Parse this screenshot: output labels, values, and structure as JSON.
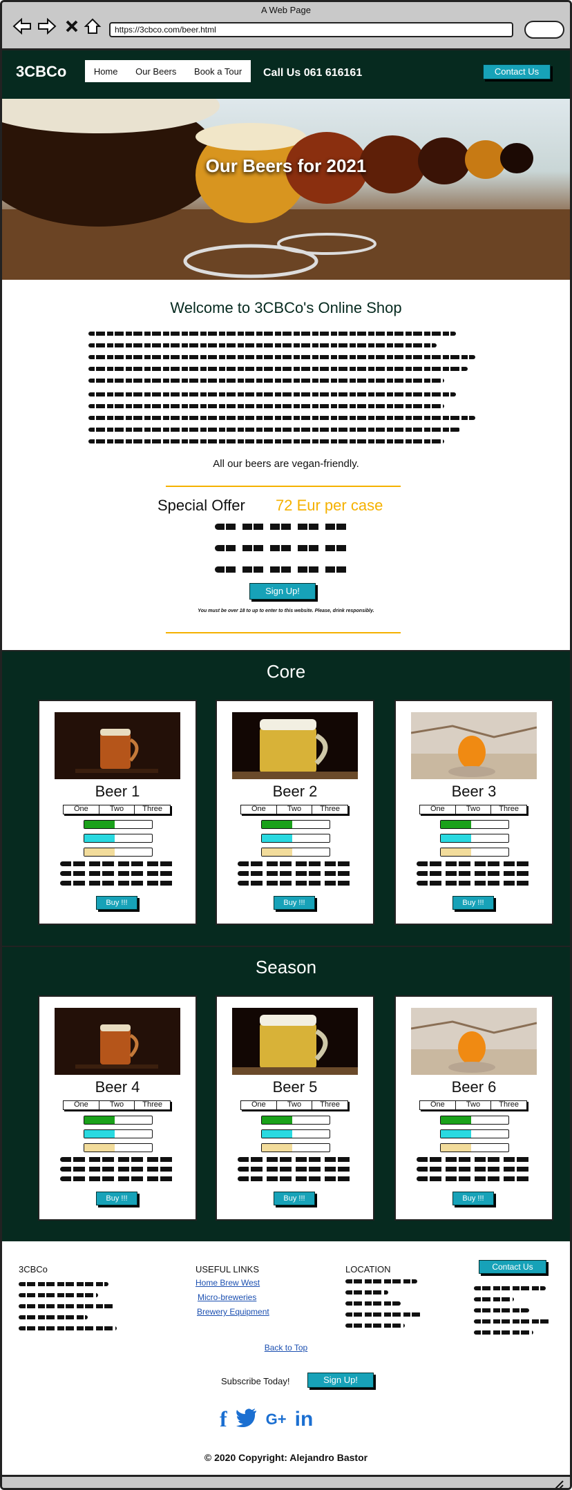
{
  "window": {
    "title": "A Web Page",
    "url": "https://3cbco.com/beer.html"
  },
  "header": {
    "brand": "3CBCo",
    "nav": [
      "Home",
      "Our Beers",
      "Book a Tour"
    ],
    "call": "Call Us 061 616161",
    "contact_label": "Contact Us"
  },
  "hero": {
    "title": "Our Beers for 2021"
  },
  "intro": {
    "welcome": "Welcome to 3CBCo's Online Shop",
    "vegan": "All our beers are vegan-friendly.",
    "offer_label": "Special Offer",
    "offer_price": "72 Eur per case",
    "signup_label": "Sign Up!",
    "disclaimer": "You must be over 18 to up to enter to this website. Please, drink responsibly."
  },
  "sections": [
    {
      "title": "Core"
    },
    {
      "title": "Season"
    }
  ],
  "cards": {
    "sizes": [
      "One",
      "Two",
      "Three"
    ],
    "buy_label": "Buy !!!",
    "bar_colors": [
      "#1aa11a",
      "#29d9e0",
      "#f2dc9b"
    ],
    "bar_levels": [
      0.45,
      0.45,
      0.45
    ],
    "beers": [
      "Beer 1",
      "Beer 2",
      "Beer 3",
      "Beer 4",
      "Beer 5",
      "Beer 6"
    ]
  },
  "footer": {
    "brand": "3CBCo",
    "links_heading": "USEFUL LINKS",
    "links": [
      "Home Brew West",
      "Micro-breweries",
      "Brewery Equipment"
    ],
    "location_heading": "LOCATION",
    "contact_label": "Contact Us",
    "back_to_top": "Back to Top",
    "subscribe": "Subscribe Today!",
    "signup_label": "Sign Up!",
    "social": [
      "f",
      "twitter",
      "G+",
      "in"
    ],
    "copyright": "© 2020 Copyright: Alejandro Bastor"
  }
}
